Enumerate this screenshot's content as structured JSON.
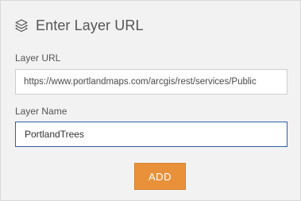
{
  "panel": {
    "title": "Enter Layer URL",
    "title_icon": "layers-icon"
  },
  "form": {
    "layer_url": {
      "label": "Layer URL",
      "value": "https://www.portlandmaps.com/arcgis/rest/services/Public"
    },
    "layer_name": {
      "label": "Layer Name",
      "value": "PortlandTrees"
    },
    "add_button_label": "ADD"
  },
  "colors": {
    "panel_background": "#f2f2f2",
    "accent_button": "#e8913a",
    "focused_border": "#2f5fa8",
    "text": "#555555"
  }
}
